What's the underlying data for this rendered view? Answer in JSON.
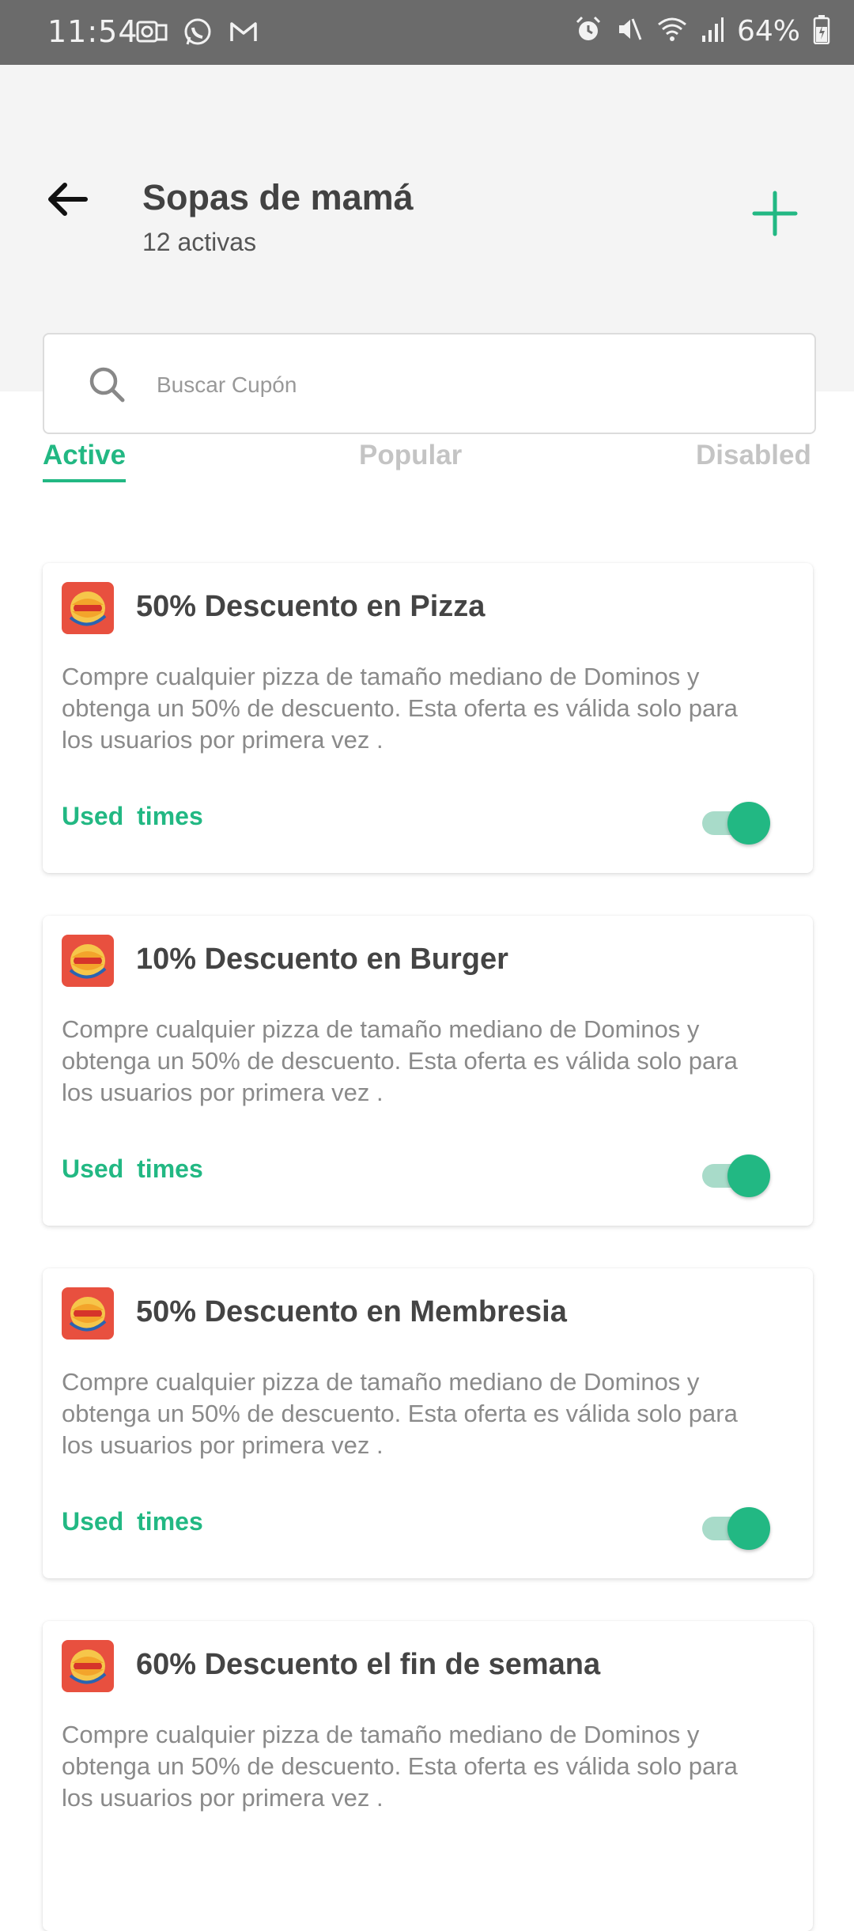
{
  "status_bar": {
    "time": "11:54",
    "battery": "64%",
    "left_icons": [
      "outlook-icon",
      "whatsapp-icon",
      "gmail-icon"
    ],
    "right_icons": [
      "alarm-icon",
      "mute-icon",
      "wifi-icon",
      "signal-icon",
      "battery-icon"
    ]
  },
  "header": {
    "title": "Sopas de mamá",
    "subtitle": "12 activas"
  },
  "search": {
    "placeholder": "Buscar Cupón"
  },
  "tabs": [
    {
      "label": "Active",
      "selected": true
    },
    {
      "label": "Popular",
      "selected": false
    },
    {
      "label": "Disabled",
      "selected": false
    }
  ],
  "coupons": [
    {
      "title": "50% Descuento en Pizza",
      "description": "Compre cualquier pizza de tamaño mediano de Dominos y obtenga un 50% de descuento. Esta oferta es válida solo para los usuarios por primera vez .",
      "used_label": "Used  times",
      "enabled": true
    },
    {
      "title": "10% Descuento en Burger",
      "description": "Compre cualquier pizza de tamaño mediano de Dominos y obtenga un 50% de descuento. Esta oferta es válida solo para los usuarios por primera vez .",
      "used_label": "Used  times",
      "enabled": true
    },
    {
      "title": "50% Descuento en Membresia",
      "description": "Compre cualquier pizza de tamaño mediano de Dominos y obtenga un 50% de descuento. Esta oferta es válida solo para los usuarios por primera vez .",
      "used_label": "Used  times",
      "enabled": true
    },
    {
      "title": "60% Descuento el fin de semana",
      "description": "Compre cualquier pizza de tamaño mediano de Dominos y obtenga un 50% de descuento. Esta oferta es válida solo para los usuarios por primera vez .",
      "used_label": "",
      "enabled": true
    }
  ],
  "colors": {
    "accent": "#22b883",
    "header_bg": "#f4f4f4",
    "status_bar_bg": "#6b6b6b",
    "logo_bg": "#e8503f"
  }
}
